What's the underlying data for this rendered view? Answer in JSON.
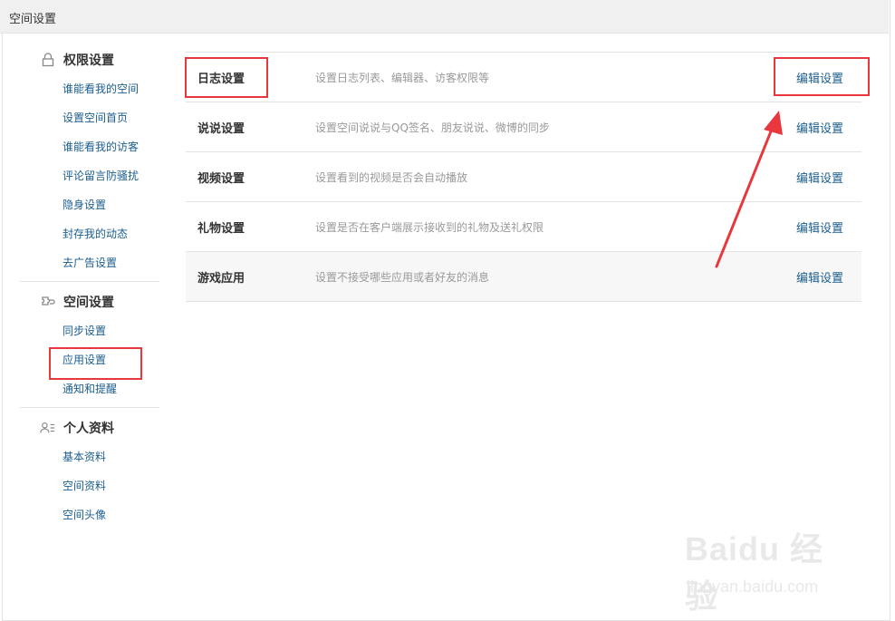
{
  "window": {
    "title": "空间设置"
  },
  "sidebar": {
    "groups": [
      {
        "title": "权限设置",
        "icon": "lock-icon",
        "items": [
          "谁能看我的空间",
          "设置空间首页",
          "谁能看我的访客",
          "评论留言防骚扰",
          "隐身设置",
          "封存我的动态",
          "去广告设置"
        ]
      },
      {
        "title": "空间设置",
        "icon": "plugin-icon",
        "items": [
          "同步设置",
          "应用设置",
          "通知和提醒"
        ]
      },
      {
        "title": "个人资料",
        "icon": "user-card-icon",
        "items": [
          "基本资料",
          "空间资料",
          "空间头像"
        ]
      }
    ]
  },
  "settings": {
    "rows": [
      {
        "name": "日志设置",
        "desc": "设置日志列表、编辑器、访客权限等",
        "action": "编辑设置"
      },
      {
        "name": "说说设置",
        "desc": "设置空间说说与QQ签名、朋友说说、微博的同步",
        "action": "编辑设置"
      },
      {
        "name": "视频设置",
        "desc": "设置看到的视频是否会自动播放",
        "action": "编辑设置"
      },
      {
        "name": "礼物设置",
        "desc": "设置是否在客户端展示接收到的礼物及送礼权限",
        "action": "编辑设置"
      },
      {
        "name": "游戏应用",
        "desc": "设置不接受哪些应用或者好友的消息",
        "action": "编辑设置"
      }
    ]
  },
  "annotation_color": "#e8373d",
  "watermark": {
    "brand": "Baidu 经验",
    "url": "jingyan.baidu.com"
  }
}
